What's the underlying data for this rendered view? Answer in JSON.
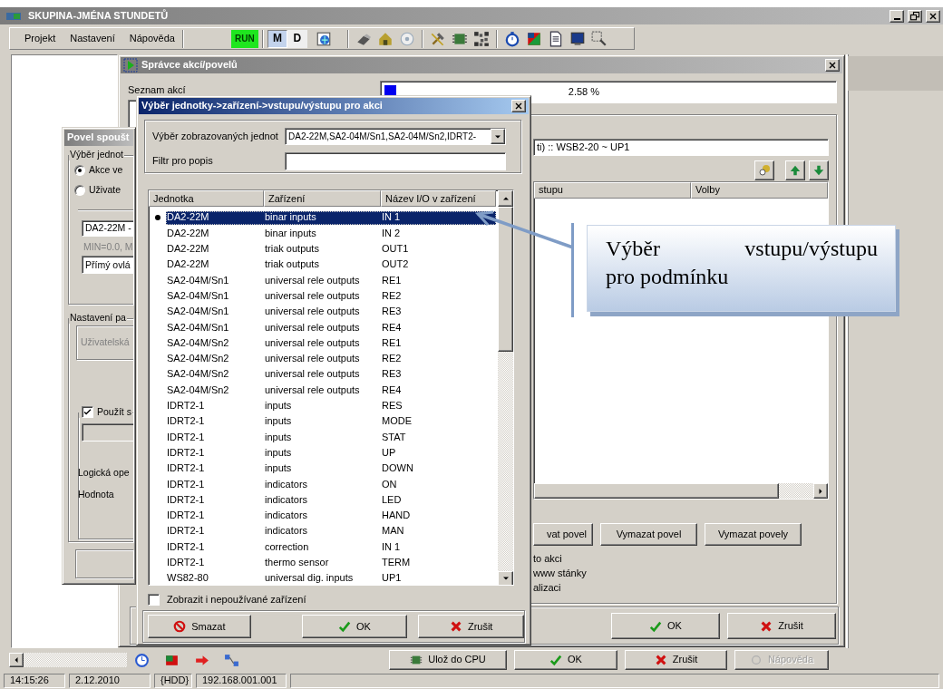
{
  "window": {
    "title": "SKUPINA-JMÉNA STUNDETŮ"
  },
  "menu": [
    {
      "label": "Projekt"
    },
    {
      "label": "Nastavení"
    },
    {
      "label": "Nápověda"
    }
  ],
  "toolbar": {
    "run": "RUN",
    "modes": [
      {
        "label": "M",
        "selected": true
      },
      {
        "label": "D",
        "selected": false
      }
    ]
  },
  "action_manager": {
    "title": "Správce akcí/povelů",
    "list_label": "Seznam akcí",
    "progress": {
      "level": 0.0258,
      "reading": "2.58 %"
    },
    "command_field": "ti) :: WSB2-20 ~ UP1",
    "columns": [
      "stupu",
      "Volby"
    ],
    "buttons": [
      "vat povel",
      "Vymazat povel",
      "Vymazat povely"
    ],
    "options": [
      "to akci",
      "www stánky",
      "alizaci"
    ],
    "dialog_buttons": [
      {
        "kind": "ok",
        "label": "OK"
      },
      {
        "kind": "cancel",
        "label": "Zrušit"
      }
    ]
  },
  "trigger_dialog": {
    "title": "Povel spoušt",
    "group_label": "Výběr jednot",
    "radios": [
      {
        "label": "Akce ve",
        "selected": true
      },
      {
        "label": "Uživate",
        "selected": false
      }
    ],
    "unit_combo": "DA2-22M -",
    "range_text": "MIN=0.0, M",
    "mode_combo": "Přímý ovlá",
    "settings_label": "Nastavení pa",
    "user_box": "Uživatelská",
    "use_check": {
      "label": "Použít s",
      "checked": true
    },
    "logic_label": "Logická ope",
    "value_label": "Hodnota"
  },
  "unit_dialog": {
    "title": "Výběr jednotky->zařízení->vstupu/výstupu pro akci",
    "units_label": "Výběr zobrazovaných jednot",
    "units_value": "DA2-22M,SA2-04M/Sn1,SA2-04M/Sn2,IDRT2-",
    "filter_label": "Filtr pro popis",
    "columns": [
      "Jednotka",
      "Zařízení",
      "Název I/O v zařízení"
    ],
    "rows": [
      {
        "unit": "DA2-22M",
        "device": "binar inputs",
        "io": "IN 1",
        "selected": true
      },
      {
        "unit": "DA2-22M",
        "device": "binar inputs",
        "io": "IN 2",
        "selected": false
      },
      {
        "unit": "DA2-22M",
        "device": "triak outputs",
        "io": "OUT1",
        "selected": false
      },
      {
        "unit": "DA2-22M",
        "device": "triak outputs",
        "io": "OUT2",
        "selected": false
      },
      {
        "unit": "SA2-04M/Sn1",
        "device": "universal rele outputs",
        "io": "RE1",
        "selected": false
      },
      {
        "unit": "SA2-04M/Sn1",
        "device": "universal rele outputs",
        "io": "RE2",
        "selected": false
      },
      {
        "unit": "SA2-04M/Sn1",
        "device": "universal rele outputs",
        "io": "RE3",
        "selected": false
      },
      {
        "unit": "SA2-04M/Sn1",
        "device": "universal rele outputs",
        "io": "RE4",
        "selected": false
      },
      {
        "unit": "SA2-04M/Sn2",
        "device": "universal rele outputs",
        "io": "RE1",
        "selected": false
      },
      {
        "unit": "SA2-04M/Sn2",
        "device": "universal rele outputs",
        "io": "RE2",
        "selected": false
      },
      {
        "unit": "SA2-04M/Sn2",
        "device": "universal rele outputs",
        "io": "RE3",
        "selected": false
      },
      {
        "unit": "SA2-04M/Sn2",
        "device": "universal rele outputs",
        "io": "RE4",
        "selected": false
      },
      {
        "unit": "IDRT2-1",
        "device": "inputs",
        "io": "RES",
        "selected": false
      },
      {
        "unit": "IDRT2-1",
        "device": "inputs",
        "io": "MODE",
        "selected": false
      },
      {
        "unit": "IDRT2-1",
        "device": "inputs",
        "io": "STAT",
        "selected": false
      },
      {
        "unit": "IDRT2-1",
        "device": "inputs",
        "io": "UP",
        "selected": false
      },
      {
        "unit": "IDRT2-1",
        "device": "inputs",
        "io": "DOWN",
        "selected": false
      },
      {
        "unit": "IDRT2-1",
        "device": "indicators",
        "io": "ON",
        "selected": false
      },
      {
        "unit": "IDRT2-1",
        "device": "indicators",
        "io": "LED",
        "selected": false
      },
      {
        "unit": "IDRT2-1",
        "device": "indicators",
        "io": "HAND",
        "selected": false
      },
      {
        "unit": "IDRT2-1",
        "device": "indicators",
        "io": "MAN",
        "selected": false
      },
      {
        "unit": "IDRT2-1",
        "device": "correction",
        "io": "IN 1",
        "selected": false
      },
      {
        "unit": "IDRT2-1",
        "device": "thermo sensor",
        "io": "TERM",
        "selected": false
      },
      {
        "unit": "WS82-80",
        "device": "universal dig. inputs",
        "io": "UP1",
        "selected": false
      }
    ],
    "show_unused": {
      "label": "Zobrazit i nepoužívané zařízení",
      "checked": false
    },
    "buttons": [
      {
        "kind": "delete",
        "label": "Smazat"
      },
      {
        "kind": "ok",
        "label": "OK"
      },
      {
        "kind": "cancel",
        "label": "Zrušit"
      }
    ]
  },
  "callout": {
    "lines": [
      "Výběr vstupu/výstupu",
      "pro podmínku"
    ]
  },
  "bottom_toolbar": {
    "buttons": [
      {
        "kind": "save",
        "label": "Ulož do CPU",
        "disabled": false
      },
      {
        "kind": "ok",
        "label": "OK",
        "disabled": false
      },
      {
        "kind": "cancel",
        "label": "Zrušit",
        "disabled": false
      },
      {
        "kind": "help",
        "label": "Nápověda",
        "disabled": true
      }
    ]
  },
  "status_bar": [
    "14:15:26",
    "2.12.2010",
    "{HDD}",
    "192.168.001.001"
  ]
}
